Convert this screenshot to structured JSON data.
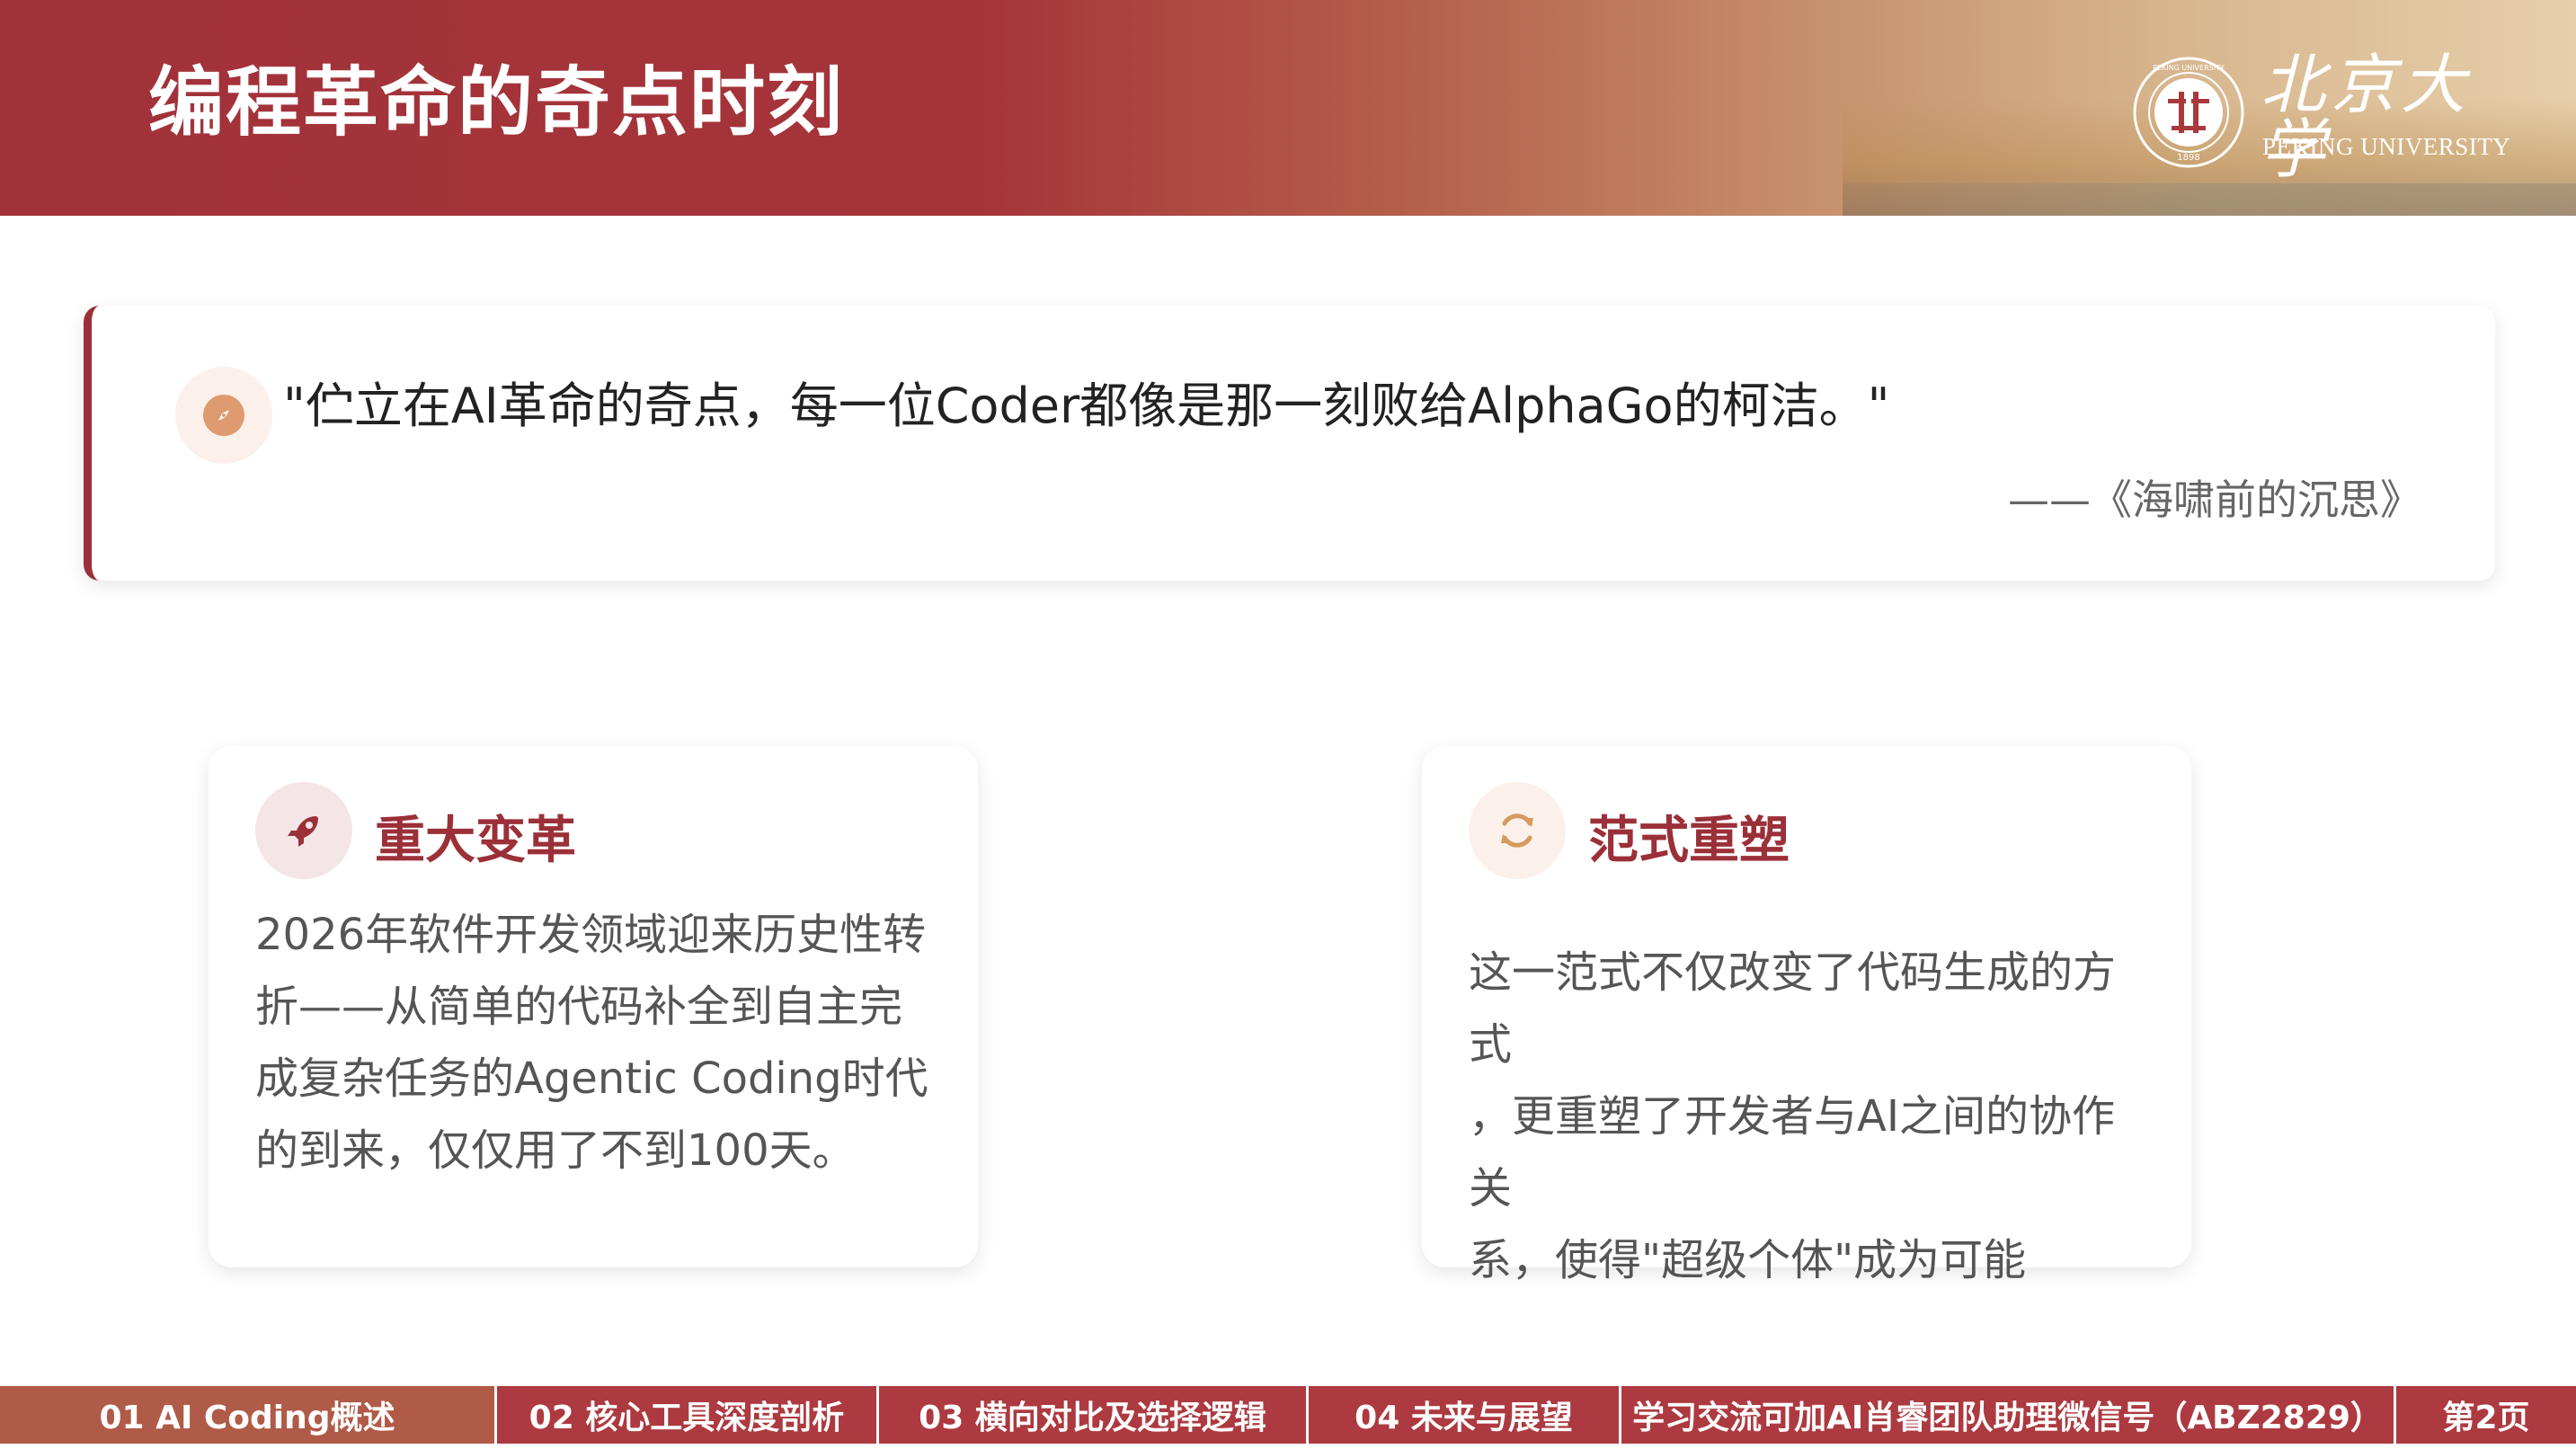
{
  "header": {
    "title": "编程革命的奇点时刻",
    "university_name": "北京大学",
    "university_name_en": "PEKING UNIVERSITY",
    "logo_year": "1898",
    "logo_ring_text": "PEKING UNIVERSITY"
  },
  "quote": {
    "icon": "compass-icon",
    "text": "\"伫立在AI革命的奇点，每一位Coder都像是那一刻败给AlphaGo的柯洁。\"",
    "source": "——《海啸前的沉思》"
  },
  "cards": [
    {
      "icon": "rocket-icon",
      "title": "重大变革",
      "body_lines": [
        "2026年软件开发领域迎来历史性转",
        "折——从简单的代码补全到自主完",
        "成复杂任务的Agentic Coding时代",
        "的到来，仅仅用了不到100天。"
      ]
    },
    {
      "icon": "refresh-icon",
      "title": "范式重塑",
      "body_lines": [
        "这一范式不仅改变了代码生成的方式",
        "，更重塑了开发者与AI之间的协作关",
        "系，使得\"超级个体\"成为可能"
      ]
    }
  ],
  "footer": {
    "items": [
      "01 AI Coding概述",
      "02 核心工具深度剖析",
      "03 横向对比及选择逻辑",
      "04 未来与展望",
      "学习交流可加AI肖睿团队助理微信号（ABZ2829）",
      "第2页"
    ]
  },
  "colors": {
    "primary": "#9b3038",
    "footer_bg": "#ad3a40",
    "footer_active": "#b05a48",
    "accent_orange": "#de9b6f"
  }
}
